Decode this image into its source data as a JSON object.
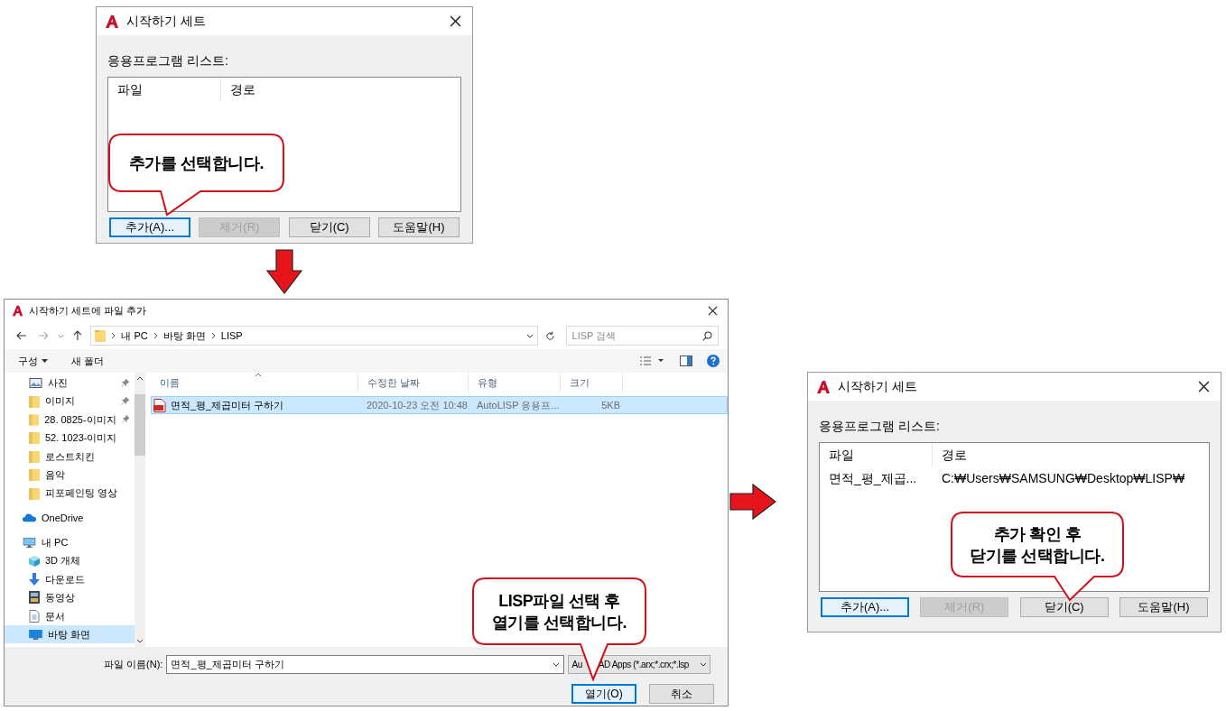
{
  "start_dialog": {
    "title": "시작하기 세트",
    "list_label": "응용프로그램 리스트:",
    "columns": [
      "파일",
      "경로"
    ],
    "buttons": [
      {
        "label": "추가(A)...",
        "focused": true,
        "disabled": false
      },
      {
        "label": "제거(R)",
        "focused": false,
        "disabled": true
      },
      {
        "label": "닫기(C)",
        "focused": false,
        "disabled": false
      },
      {
        "label": "도움말(H)",
        "focused": false,
        "disabled": false
      }
    ],
    "callout": "추가를 선택합니다."
  },
  "file_dialog": {
    "title": "시작하기 세트에 파일 추가",
    "breadcrumb": [
      "내 PC",
      "바탕 화면",
      "LISP"
    ],
    "search": {
      "placeholder": "LISP 검색"
    },
    "toolbar": [
      "구성",
      "새 폴더"
    ],
    "nav": [
      {
        "label": "사진",
        "kind": "pictures",
        "pinned": true,
        "selected": false
      },
      {
        "label": "이미지",
        "kind": "folder",
        "pinned": true,
        "selected": false
      },
      {
        "label": "28. 0825-이미지",
        "kind": "folder",
        "pinned": true,
        "selected": false
      },
      {
        "label": "52. 1023-이미지",
        "kind": "folder",
        "pinned": false,
        "selected": false
      },
      {
        "label": "로스트치킨",
        "kind": "folder",
        "pinned": false,
        "selected": false
      },
      {
        "label": "음악",
        "kind": "folder",
        "pinned": false,
        "selected": false
      },
      {
        "label": "피포페인팅 영상",
        "kind": "folder",
        "pinned": false,
        "selected": false
      },
      {
        "label": "OneDrive",
        "kind": "cloud",
        "pinned": false,
        "selected": false
      },
      {
        "label": "내 PC",
        "kind": "pc",
        "pinned": false,
        "selected": false,
        "children": [
          {
            "label": "3D 개체",
            "kind": "cube",
            "pinned": false,
            "selected": false
          },
          {
            "label": "다운로드",
            "kind": "download",
            "pinned": false,
            "selected": false
          },
          {
            "label": "동영상",
            "kind": "video",
            "pinned": false,
            "selected": false
          },
          {
            "label": "문서",
            "kind": "document",
            "pinned": false,
            "selected": false
          },
          {
            "label": "바탕 화면",
            "kind": "desktop",
            "pinned": false,
            "selected": true
          }
        ]
      }
    ],
    "columns": [
      "이름",
      "수정한 날짜",
      "유형",
      "크기"
    ],
    "files": [
      {
        "name": "면적_평_제곱미터 구하기",
        "modified": "2020-10-23 오전 10:48",
        "type": "AutoLISP 응용프...",
        "size": "5KB",
        "selected": true
      }
    ],
    "filename_label": "파일 이름(N):",
    "filename": "면적_평_제곱미터 구하기",
    "filter": [
      "Au",
      "AD Apps (*.arx;*.crx;*.lsp"
    ],
    "buttons": [
      {
        "label": "열기(O)",
        "focused": true
      },
      {
        "label": "취소",
        "focused": false
      }
    ],
    "callout": "LISP파일 선택 후\n열기를 선택합니다."
  },
  "result_dialog": {
    "title": "시작하기 세트",
    "list_label": "응용프로그램 리스트:",
    "columns": [
      "파일",
      "경로"
    ],
    "rows": [
      [
        "면적_평_제곱...",
        "C:₩Users₩SAMSUNG₩Desktop₩LISP₩"
      ]
    ],
    "buttons": [
      {
        "label": "추가(A)...",
        "focused": true,
        "disabled": false
      },
      {
        "label": "제거(R)",
        "focused": false,
        "disabled": true
      },
      {
        "label": "닫기(C)",
        "focused": false,
        "disabled": false
      },
      {
        "label": "도움말(H)",
        "focused": false,
        "disabled": false
      }
    ],
    "callout": "추가 확인 후\n닫기를 선택합니다."
  }
}
